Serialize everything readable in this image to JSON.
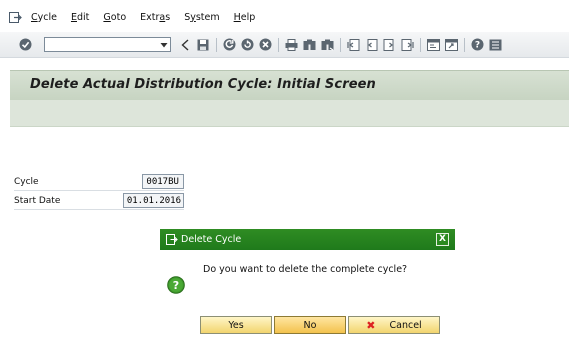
{
  "menubar": {
    "items": [
      {
        "label": "Cycle"
      },
      {
        "label": "Edit"
      },
      {
        "label": "Goto"
      },
      {
        "label": "Extras"
      },
      {
        "label": "System"
      },
      {
        "label": "Help"
      }
    ]
  },
  "toolbar": {
    "command_field": {
      "value": "",
      "placeholder": ""
    },
    "icons": [
      "enter-icon",
      "back-icon",
      "save-icon",
      "back-green-icon",
      "exit-icon",
      "cancel-icon",
      "print-icon",
      "find-icon",
      "find-next-icon",
      "first-page-icon",
      "previous-page-icon",
      "next-page-icon",
      "last-page-icon",
      "create-session-icon",
      "shortcut-icon",
      "help-icon",
      "customize-layout-icon"
    ]
  },
  "page": {
    "title": "Delete Actual Distribution Cycle: Initial Screen"
  },
  "form": {
    "cycle": {
      "label": "Cycle",
      "value": "0017BU"
    },
    "start_date": {
      "label": "Start Date",
      "value": "01.01.2016"
    }
  },
  "dialog": {
    "title": "Delete Cycle",
    "close_label": "X",
    "message": "Do you want to delete the complete cycle?",
    "buttons": {
      "yes": "Yes",
      "no": "No",
      "cancel": "Cancel"
    }
  },
  "colors": {
    "dialog_titlebar": "#2a8520",
    "title_area": "#d0dccb",
    "button_gold": "#f2d46e"
  }
}
